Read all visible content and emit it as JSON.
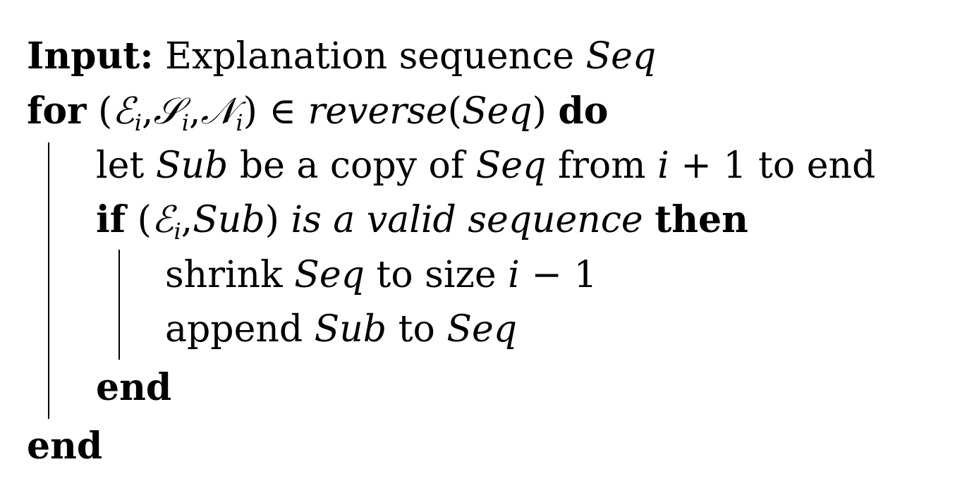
{
  "algorithm": {
    "input_kw": "Input:",
    "input_text": "Explanation sequence",
    "input_var": "Seq",
    "for_kw": "for",
    "for_tuple_open": "(",
    "for_e": "ℰ",
    "for_s": "𝒮",
    "for_n": "𝒩",
    "sub_i": "i",
    "comma": ",",
    "for_tuple_close": ")",
    "elem_of": "∈",
    "reverse_fn": "reverse",
    "paren_open": "(",
    "paren_close": ")",
    "seq": "Seq",
    "do_kw": "do",
    "let_text": "let",
    "sub_var": "Sub",
    "be_copy_text": "be a copy of",
    "from_text": "from",
    "i_var": "i",
    "plus_one": "+ 1",
    "to_end_text": "to end",
    "if_kw": "if",
    "valid_seq_text": "is a valid sequence",
    "then_kw": "then",
    "shrink_text": "shrink",
    "to_size_text": "to size",
    "minus_one": "− 1",
    "append_text": "append",
    "to_text": "to",
    "end_kw": "end",
    "end_kw_outer": "end"
  }
}
